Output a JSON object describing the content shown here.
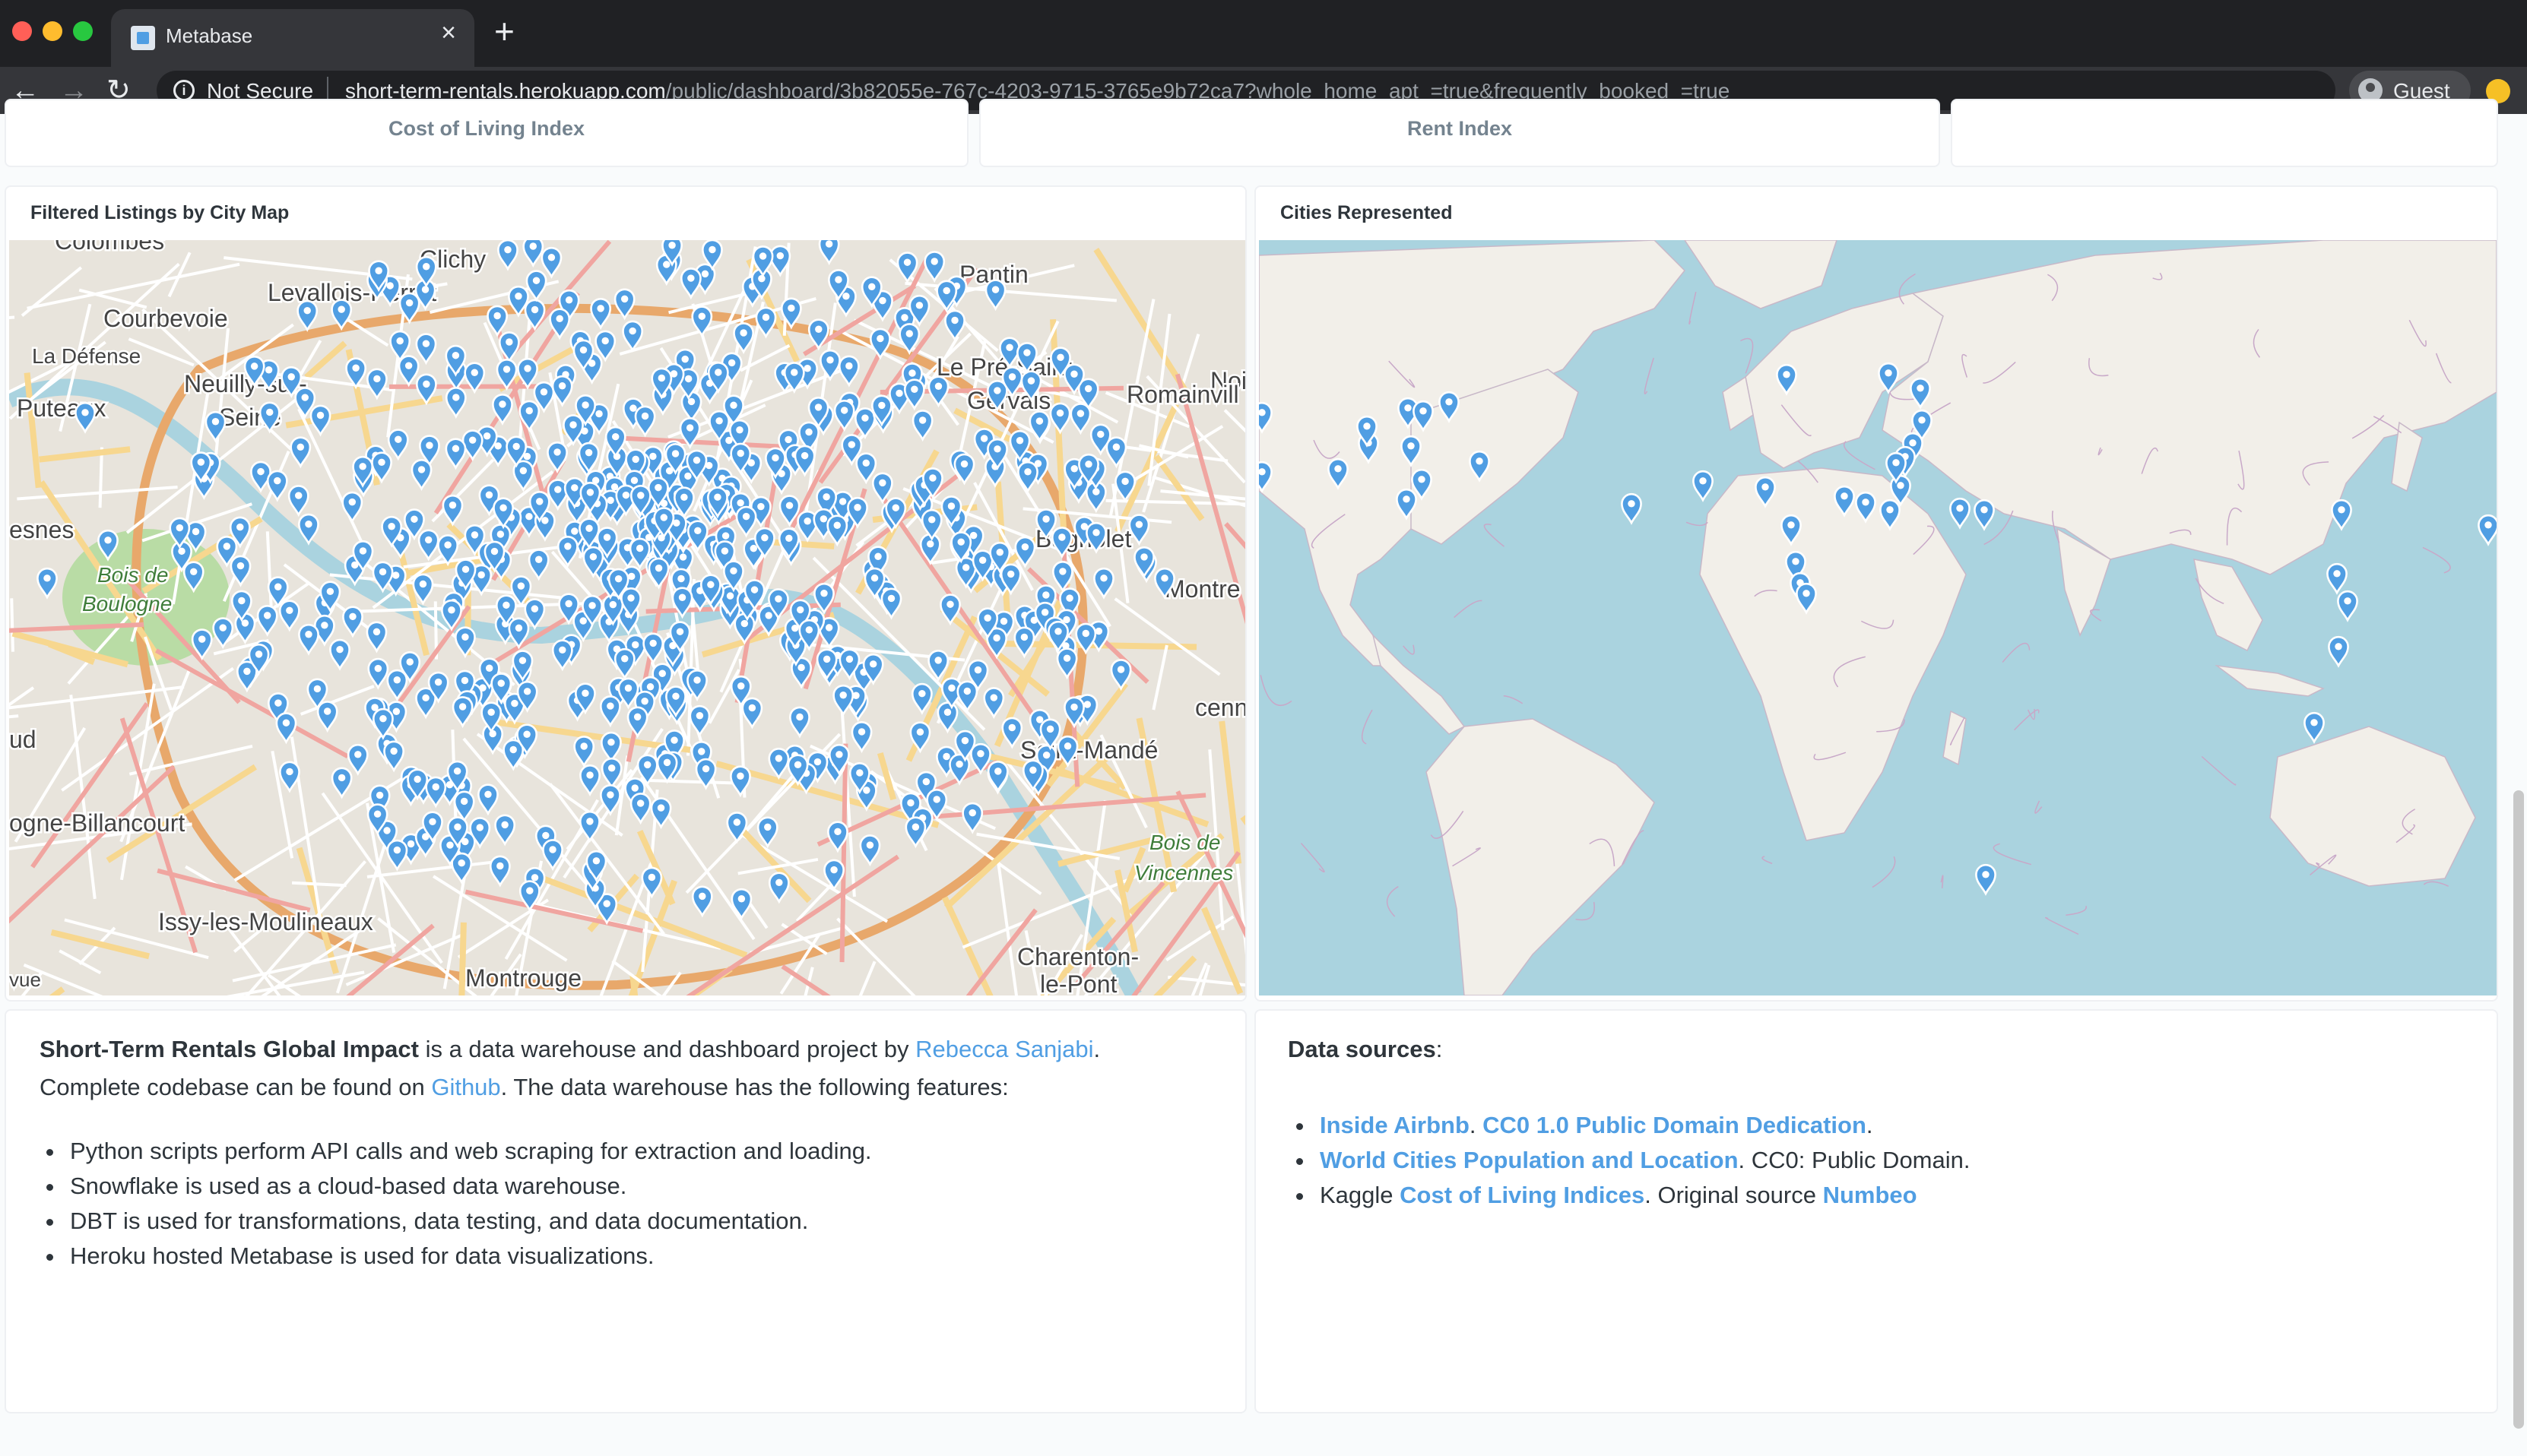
{
  "browser": {
    "tab_title": "Metabase",
    "tab_close": "×",
    "new_tab": "+",
    "security_label": "Not Secure",
    "url_host": "short-term-rentals.herokuapp.com",
    "url_path": "/public/dashboard/3b82055e-767c-4203-9715-3765e9b72ca7?whole_home_apt_=true&frequently_booked_=true",
    "profile_label": "Guest"
  },
  "dashboard": {
    "scalar_cards": [
      {
        "title": "Cost of Living Index"
      },
      {
        "title": "Rent Index"
      },
      {
        "title": ""
      }
    ],
    "map_cards": [
      {
        "title": "Filtered Listings by City Map"
      },
      {
        "title": "Cities Represented"
      }
    ],
    "paris_labels": {
      "colombes": "Colombes",
      "clichy": "Clichy",
      "pantin": "Pantin",
      "courbevoie": "Courbevoie",
      "levallois": "Levallois-Perret",
      "ladefense": "La Défense",
      "noi": "Noi",
      "pre_saint": "Le Pré-Saint-",
      "gervais": "Gervais",
      "neuilly": "Neuilly-sur-",
      "seine": "Seine",
      "romainvill": "Romainvill",
      "puteaux": "Puteaux",
      "esnes": "esnes",
      "bagnolet": "Bagnolet",
      "bois": "Bois de",
      "boulogne": "Boulogne",
      "montre": "Montre",
      "cenn": "cenn",
      "ud": "ud",
      "saint_mande": "Saint-Mandé",
      "billancourt": "ogne-Billancourt",
      "bois_v": "Bois de",
      "vincennes": "Vincennes",
      "issy": "Issy-les-Moulineaux",
      "charenton": "Charenton-",
      "le_pont": "le-Pont",
      "montrouge": "Montrouge",
      "vue": "vue"
    },
    "about": {
      "name": "Short-Term Rentals Global Impact",
      "intro": " is a data warehouse and dashboard project by ",
      "author": "Rebecca Sanjabi",
      "mid": ". Complete codebase can be found on ",
      "github": "Github",
      "end": ". The data warehouse has the following features:",
      "features": [
        "Python scripts perform API calls and web scraping for extraction and loading.",
        "Snowflake is used as a cloud-based data warehouse.",
        "DBT is used for transformations, data testing, and data documentation.",
        "Heroku hosted Metabase is used for data visualizations."
      ]
    },
    "sources": {
      "title": "Data sources",
      "colon": ":",
      "s1_a": "Inside Airbnb",
      "s1_sep": ". ",
      "s1_b": "CC0 1.0 Public Domain Dedication",
      "s1_end": ".",
      "s2_a": "World Cities Population and Location",
      "s2_end": ". CC0: Public Domain.",
      "s3_pre": "Kaggle ",
      "s3_a": "Cost of Living Indices",
      "s3_mid": ". Original source ",
      "s3_b": "Numbeo"
    }
  },
  "colors": {
    "accent": "#509ee3",
    "text": "#2e353b",
    "muted": "#74838f",
    "ocean": "#aad3df",
    "land": "#f2efe9"
  }
}
